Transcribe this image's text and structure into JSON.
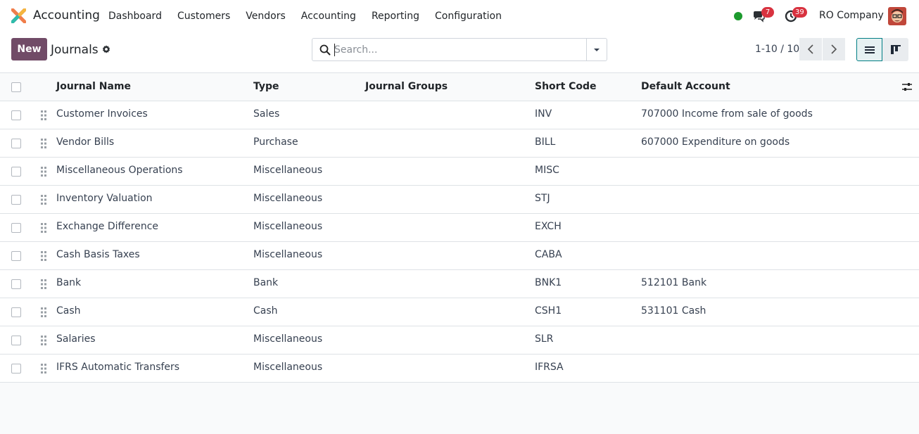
{
  "app": {
    "name": "Accounting",
    "menu": [
      "Dashboard",
      "Customers",
      "Vendors",
      "Accounting",
      "Reporting",
      "Configuration"
    ],
    "messages_count": "7",
    "activities_count": "39",
    "company": "RO Company",
    "presence_color": "#1c9a2d"
  },
  "control": {
    "new_label": "New",
    "title": "Journals",
    "search_placeholder": "Search...",
    "pager": "1-10 / 10"
  },
  "table": {
    "columns": [
      "Journal Name",
      "Type",
      "Journal Groups",
      "Short Code",
      "Default Account"
    ],
    "rows": [
      {
        "name": "Customer Invoices",
        "type": "Sales",
        "groups": "",
        "code": "INV",
        "account": "707000 Income from sale of goods"
      },
      {
        "name": "Vendor Bills",
        "type": "Purchase",
        "groups": "",
        "code": "BILL",
        "account": "607000 Expenditure on goods"
      },
      {
        "name": "Miscellaneous Operations",
        "type": "Miscellaneous",
        "groups": "",
        "code": "MISC",
        "account": ""
      },
      {
        "name": "Inventory Valuation",
        "type": "Miscellaneous",
        "groups": "",
        "code": "STJ",
        "account": ""
      },
      {
        "name": "Exchange Difference",
        "type": "Miscellaneous",
        "groups": "",
        "code": "EXCH",
        "account": ""
      },
      {
        "name": "Cash Basis Taxes",
        "type": "Miscellaneous",
        "groups": "",
        "code": "CABA",
        "account": ""
      },
      {
        "name": "Bank",
        "type": "Bank",
        "groups": "",
        "code": "BNK1",
        "account": "512101 Bank"
      },
      {
        "name": "Cash",
        "type": "Cash",
        "groups": "",
        "code": "CSH1",
        "account": "531101 Cash"
      },
      {
        "name": "Salaries",
        "type": "Miscellaneous",
        "groups": "",
        "code": "SLR",
        "account": ""
      },
      {
        "name": "IFRS Automatic Transfers",
        "type": "Miscellaneous",
        "groups": "",
        "code": "IFRSA",
        "account": ""
      }
    ]
  },
  "colors": {
    "brand": "#714b67",
    "accent": "#017e84",
    "badge": "#d8323f"
  }
}
